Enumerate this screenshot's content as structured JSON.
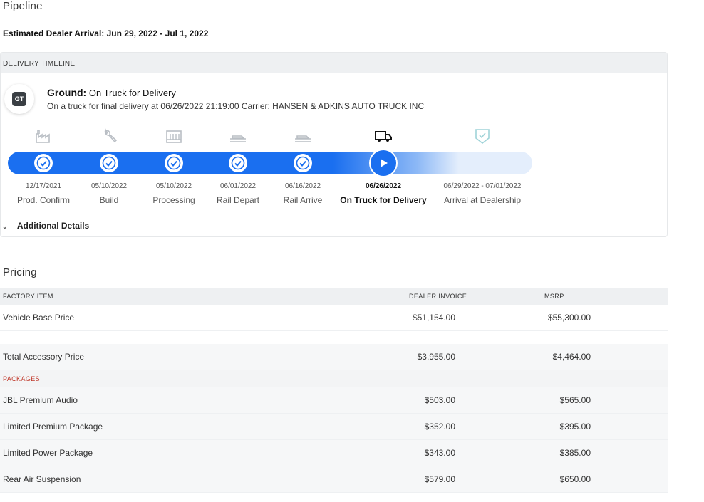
{
  "pipeline": {
    "title": "Pipeline",
    "estimated_arrival": "Estimated Dealer Arrival: Jun 29, 2022 - Jul 1, 2022"
  },
  "timeline": {
    "header": "DELIVERY TIMELINE",
    "badge": "GT",
    "ground_label": "Ground:",
    "ground_status": "On Truck for Delivery",
    "description": "On a truck for final delivery at 06/26/2022 21:19:00 Carrier: HANSEN & ADKINS AUTO TRUCK INC",
    "stages": [
      {
        "date": "12/17/2021",
        "label": "Prod. Confirm",
        "icon": "factory-icon",
        "state": "complete"
      },
      {
        "date": "05/10/2022",
        "label": "Build",
        "icon": "wrench-icon",
        "state": "complete"
      },
      {
        "date": "05/10/2022",
        "label": "Processing",
        "icon": "processing-icon",
        "state": "complete"
      },
      {
        "date": "06/01/2022",
        "label": "Rail Depart",
        "icon": "rail-icon",
        "state": "complete"
      },
      {
        "date": "06/16/2022",
        "label": "Rail Arrive",
        "icon": "rail-icon",
        "state": "complete"
      },
      {
        "date": "06/26/2022",
        "label": "On Truck for Delivery",
        "icon": "truck-icon",
        "state": "current"
      },
      {
        "date": "06/29/2022 - 07/01/2022",
        "label": "Arrival at Dealership",
        "icon": "shield-check-icon",
        "state": "pending"
      }
    ],
    "additional_details": "Additional Details",
    "accent_color": "#1a6ff0"
  },
  "pricing": {
    "title": "Pricing",
    "columns": {
      "item": "FACTORY ITEM",
      "invoice": "DEALER INVOICE",
      "msrp": "MSRP"
    },
    "base": {
      "name": "Vehicle Base Price",
      "invoice": "$51,154.00",
      "msrp": "$55,300.00"
    },
    "accessory_total": {
      "name": "Total Accessory Price",
      "invoice": "$3,955.00",
      "msrp": "$4,464.00"
    },
    "packages_label": "PACKAGES",
    "packages": [
      {
        "name": "JBL Premium Audio",
        "invoice": "$503.00",
        "msrp": "$565.00"
      },
      {
        "name": "Limited Premium Package",
        "invoice": "$352.00",
        "msrp": "$395.00"
      },
      {
        "name": "Limited Power Package",
        "invoice": "$343.00",
        "msrp": "$385.00"
      },
      {
        "name": "Rear Air Suspension",
        "invoice": "$579.00",
        "msrp": "$650.00"
      }
    ]
  }
}
